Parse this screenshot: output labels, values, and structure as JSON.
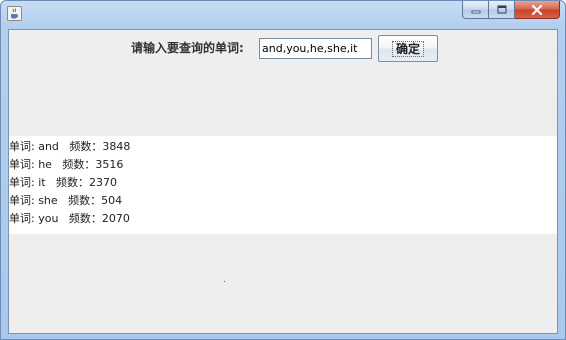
{
  "window": {
    "icon": "java-cup-icon",
    "controls": [
      "minimize-icon",
      "maximize-icon",
      "close-icon"
    ]
  },
  "form": {
    "prompt_label": "请输入要查询的单词:",
    "input_value": "and,you,he,she,it",
    "ok_button_label": "确定"
  },
  "results": [
    "单词: and   频数：3848",
    "单词: he   频数：3516",
    "单词: it   频数：2370",
    "单词: she   频数：504",
    "单词: you   频数：2070"
  ]
}
